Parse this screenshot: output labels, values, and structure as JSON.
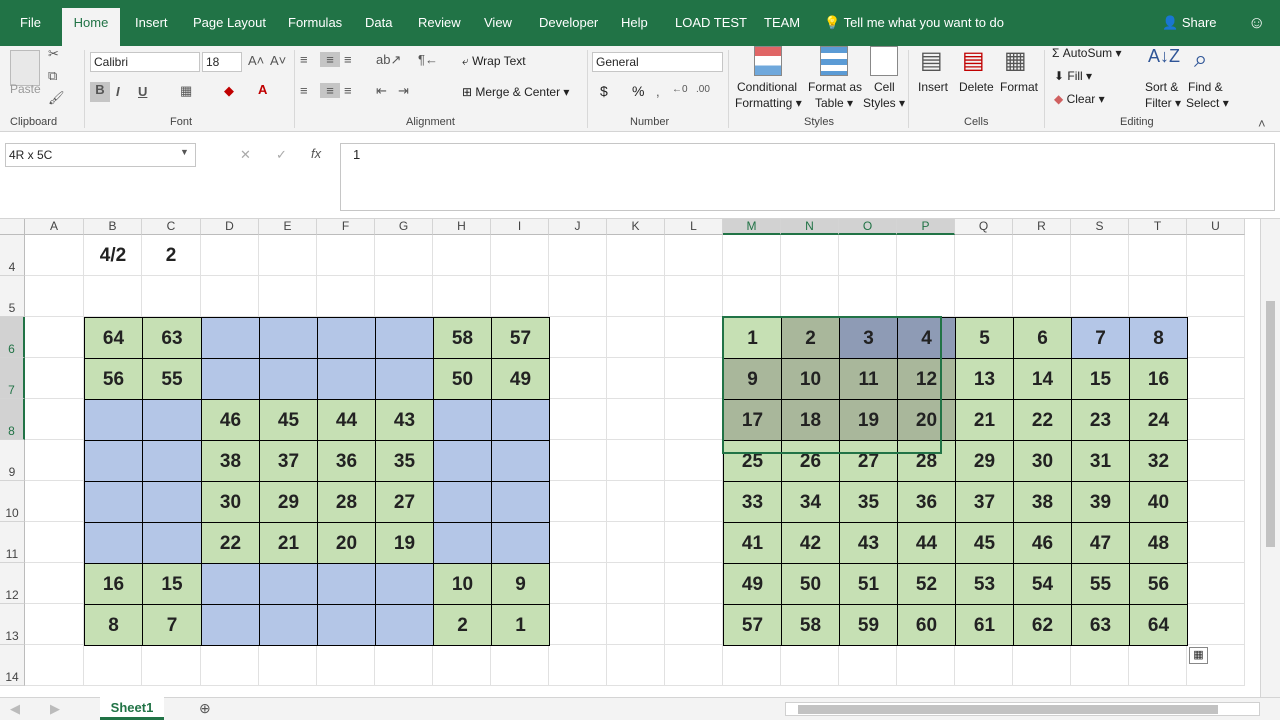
{
  "tabs": [
    "File",
    "Home",
    "Insert",
    "Page Layout",
    "Formulas",
    "Data",
    "Review",
    "View",
    "Developer",
    "Help",
    "LOAD TEST",
    "TEAM"
  ],
  "tell_me": "Tell me what you want to do",
  "share": "Share",
  "ribbon": {
    "clipboard": {
      "label": "Clipboard",
      "paste": "Paste"
    },
    "font": {
      "label": "Font",
      "name": "Calibri",
      "size": "18",
      "bold": "B",
      "italic": "I",
      "underline": "U"
    },
    "alignment": {
      "label": "Alignment",
      "wrap": "Wrap Text",
      "merge": "Merge & Center"
    },
    "number": {
      "label": "Number",
      "format": "General",
      "currency": "$",
      "percent": "%"
    },
    "styles": {
      "label": "Styles",
      "cond1": "Conditional",
      "cond2": "Formatting",
      "fmt1": "Format as",
      "fmt2": "Table",
      "cell1": "Cell",
      "cell2": "Styles"
    },
    "cells": {
      "label": "Cells",
      "insert": "Insert",
      "delete": "Delete",
      "format": "Format"
    },
    "editing": {
      "label": "Editing",
      "autosum": "AutoSum",
      "fill": "Fill",
      "clear": "Clear",
      "sort1": "Sort &",
      "sort2": "Filter",
      "find1": "Find &",
      "find2": "Select"
    }
  },
  "formula_bar": {
    "name_box": "4R x 5C",
    "fx": "fx",
    "value": "1"
  },
  "columns": [
    "A",
    "B",
    "C",
    "D",
    "E",
    "F",
    "G",
    "H",
    "I",
    "J",
    "K",
    "L",
    "M",
    "N",
    "O",
    "P",
    "Q",
    "R",
    "S",
    "T",
    "U"
  ],
  "rows": [
    "4",
    "5",
    "6",
    "7",
    "8",
    "9",
    "10",
    "11",
    "12",
    "13",
    "14"
  ],
  "cells": {
    "b4": "4/2",
    "c4": "2"
  },
  "left_grid": [
    [
      "64",
      "63",
      "",
      "",
      "",
      "",
      "58",
      "57"
    ],
    [
      "56",
      "55",
      "",
      "",
      "",
      "",
      "50",
      "49"
    ],
    [
      "",
      "",
      "46",
      "45",
      "44",
      "43",
      "",
      ""
    ],
    [
      "",
      "",
      "38",
      "37",
      "36",
      "35",
      "",
      ""
    ],
    [
      "",
      "",
      "30",
      "29",
      "28",
      "27",
      "",
      ""
    ],
    [
      "",
      "",
      "22",
      "21",
      "20",
      "19",
      "",
      ""
    ],
    [
      "16",
      "15",
      "",
      "",
      "",
      "",
      "10",
      "9"
    ],
    [
      "8",
      "7",
      "",
      "",
      "",
      "",
      "2",
      "1"
    ]
  ],
  "right_grid": [
    [
      "1",
      "2",
      "3",
      "4",
      "5",
      "6",
      "7",
      "8"
    ],
    [
      "9",
      "10",
      "11",
      "12",
      "13",
      "14",
      "15",
      "16"
    ],
    [
      "17",
      "18",
      "19",
      "20",
      "21",
      "22",
      "23",
      "24"
    ],
    [
      "25",
      "26",
      "27",
      "28",
      "29",
      "30",
      "31",
      "32"
    ],
    [
      "33",
      "34",
      "35",
      "36",
      "37",
      "38",
      "39",
      "40"
    ],
    [
      "41",
      "42",
      "43",
      "44",
      "45",
      "46",
      "47",
      "48"
    ],
    [
      "49",
      "50",
      "51",
      "52",
      "53",
      "54",
      "55",
      "56"
    ],
    [
      "57",
      "58",
      "59",
      "60",
      "61",
      "62",
      "63",
      "64"
    ]
  ],
  "colors": {
    "green": "#c6e0b4",
    "blue": "#b4c6e7",
    "excel": "#217346",
    "sel_green": "#a9b79b",
    "sel_blue": "#8e9bb5"
  },
  "sheet_tab": "Sheet1"
}
